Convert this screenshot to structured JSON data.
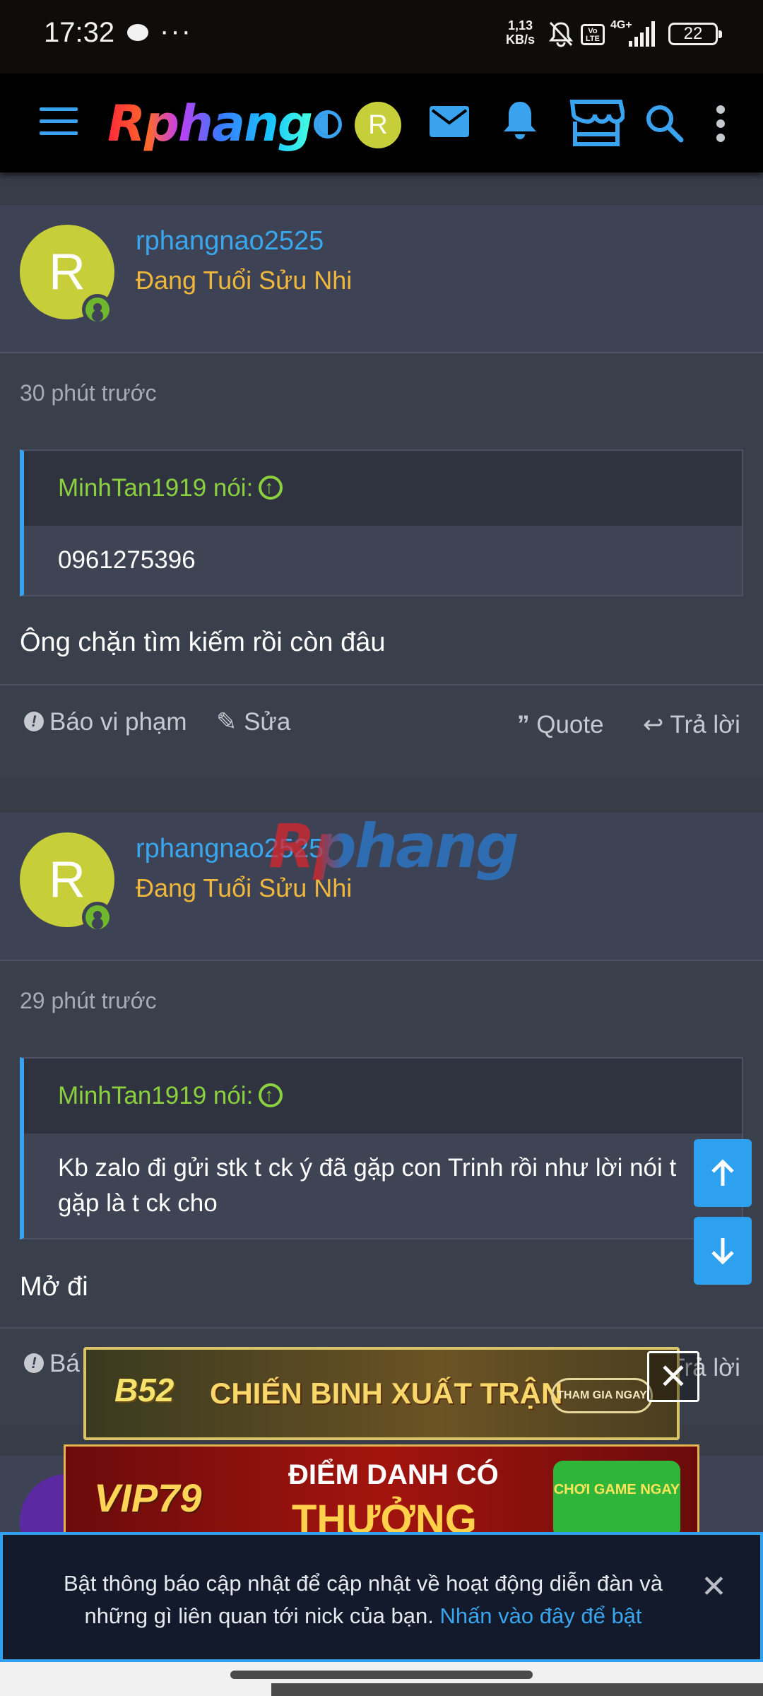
{
  "status_bar": {
    "time": "17:32",
    "dots": "···",
    "net_rate_value": "1,13",
    "net_rate_unit": "KB/s",
    "volte": "Vo LTE",
    "signal": "4G+",
    "battery": "22"
  },
  "header": {
    "logo": "Rphang",
    "avatar_letter": "R",
    "accent": "#3aa3f0"
  },
  "posts": [
    {
      "avatar_letter": "R",
      "username": "rphangnao2525",
      "user_title": "Đang Tuổi Sửu Nhi",
      "time": "30 phút trước",
      "quote_author": "MinhTan1919 nói:",
      "quote_text": "0961275396",
      "text": "Ông chặn tìm kiếm rồi còn đâu",
      "actions": {
        "report": "Báo vi phạm",
        "edit": "Sửa",
        "quote": "Quote",
        "reply": "Trả lời"
      }
    },
    {
      "avatar_letter": "R",
      "username": "rphangnao2525",
      "user_title": "Đang Tuổi Sửu Nhi",
      "time": "29 phút trước",
      "quote_author": "MinhTan1919 nói:",
      "quote_text": "Kb zalo đi gửi stk t ck ý đã gặp con Trinh rồi như lời nói t gặp là t ck cho",
      "text": "Mở đi",
      "actions": {
        "report": "Bá",
        "reply": "Trả lời"
      }
    }
  ],
  "watermark": "Rphang",
  "ads": {
    "ad1": {
      "brand": "B52",
      "headline": "CHIẾN BINH XUẤT TRẬN",
      "cta": "THAM GIA NGAY",
      "close": "✕"
    },
    "ad2": {
      "brand": "VIP79",
      "line1": "ĐIỂM DANH CÓ",
      "line2": "THƯỞNG",
      "cta": "CHƠI GAME NGAY"
    }
  },
  "notice": {
    "text": "Bật thông báo cập nhật để cập nhật về hoạt động diễn đàn và những gì liên quan tới nick của bạn.",
    "link": "Nhấn vào đây để bật",
    "close": "✕"
  },
  "colors": {
    "username": "#3aa6ee",
    "user_title": "#efb73c",
    "quote_author": "#8bd13f",
    "background": "#383c47"
  }
}
